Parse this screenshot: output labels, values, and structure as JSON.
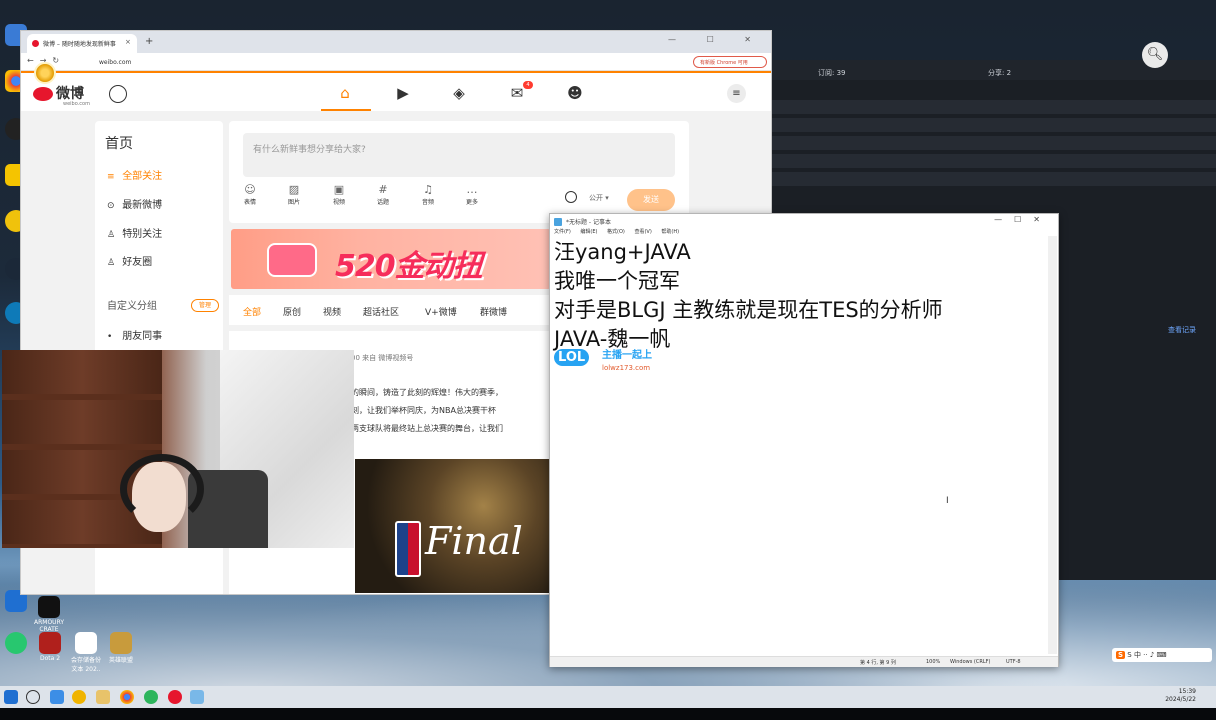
{
  "browser": {
    "tab_title": "微博 – 随时随地发现新鲜事",
    "url": "weibo.com",
    "chrome_badge": "有新版 Chrome 可用",
    "tab_close": "×",
    "new_tab": "+",
    "window_controls": "— ☐ ✕"
  },
  "weibo": {
    "logo": "微博",
    "logo_sub": "weibo.com",
    "message_badge": "4",
    "sidebar": {
      "title": "首页",
      "items": [
        {
          "label": "全部关注",
          "icon": "≡"
        },
        {
          "label": "最新微博",
          "icon": "⊙"
        },
        {
          "label": "特别关注",
          "icon": "♙"
        },
        {
          "label": "好友圈",
          "icon": "♙"
        }
      ],
      "custom_group": "自定义分组",
      "manage": "管理",
      "friends_colleagues": "朋友同事"
    },
    "composer": {
      "placeholder": "有什么新鲜事想分享给大家?",
      "tools": [
        {
          "label": "表情",
          "icon": "☺"
        },
        {
          "label": "图片",
          "icon": "▨"
        },
        {
          "label": "视频",
          "icon": "▣"
        },
        {
          "label": "话题",
          "icon": "#"
        },
        {
          "label": "音频",
          "icon": "♫"
        },
        {
          "label": "更多",
          "icon": "…"
        }
      ],
      "visibility": "公开 ▾",
      "publish": "发送"
    },
    "banner_text": "520金动扭",
    "feed_tabs": [
      "全部",
      "原创",
      "视频",
      "超话社区",
      "V+微博",
      "群微博"
    ],
    "post": {
      "meta": "00 来自 微博视频号",
      "lines": [
        "的瞬间，铸造了此刻的辉煌！伟大的赛季，",
        "刻，让我们举杯同庆，为NBA总决赛干杯",
        "两支球队将最终站上总决赛的舞台，让我们"
      ],
      "image_text": "Final"
    }
  },
  "notepad": {
    "title": "*无标题 - 记事本",
    "menu": [
      "文件(F)",
      "编辑(E)",
      "格式(O)",
      "查看(V)",
      "帮助(H)"
    ],
    "content": "汪yang+JAVA\n我唯一个冠军\n对手是BLGJ 主教练就是现在TES的分析师\nJAVA-魏一帆",
    "status": {
      "position": "第 4 行, 第 9 列",
      "zoom": "100%",
      "line_ending": "Windows (CRLF)",
      "encoding": "UTF-8"
    }
  },
  "watermark": {
    "logo": "LOL",
    "cn": "主播一起上",
    "url": "lolwz173.com"
  },
  "bgapp": {
    "label_left": "订阅: 39",
    "label_right": "分享: 2",
    "side_link": "查看记录"
  },
  "taskbar": {
    "time": "15:39",
    "date": "2024/5/22"
  },
  "desktop_icons": [
    "ARMOURY CRATE",
    "Dota 2",
    "会存储备份 文本 202..",
    "英雄联盟"
  ],
  "ime": "S 中 ·· ♪ ⌨"
}
